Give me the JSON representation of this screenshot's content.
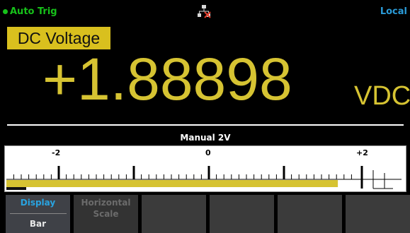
{
  "status": {
    "trigger_mode": "Auto Trig",
    "remote_mode": "Local",
    "connection_icon": "lan-network-icon",
    "colors": {
      "trigger": "#17c11a",
      "remote": "#2a9bd8"
    }
  },
  "measurement": {
    "function": "DC Voltage",
    "reading": "+1.88898",
    "unit": "VDC",
    "colors": {
      "label_bg": "#d9c01e",
      "reading": "#d6c332"
    }
  },
  "bar_graph": {
    "range_label": "Manual 2V",
    "scale_labels": [
      "-2",
      "0",
      "+2"
    ],
    "fraction_of_range": 0.94
  },
  "softkeys": [
    {
      "label_top": "Display",
      "label_bottom": "Bar"
    },
    {
      "label_top": "Horizontal",
      "label_bottom": "Scale"
    },
    {
      "label_top": ""
    },
    {
      "label_top": ""
    },
    {
      "label_top": ""
    },
    {
      "label_top": ""
    }
  ]
}
